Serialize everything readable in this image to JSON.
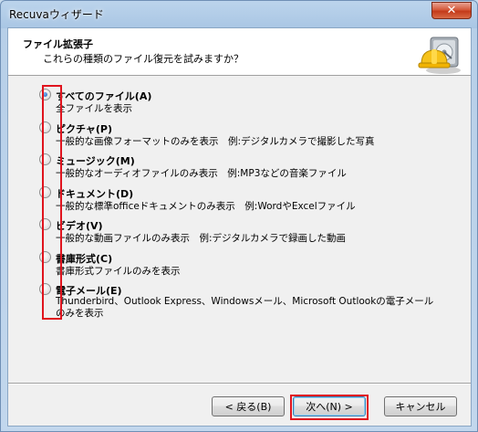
{
  "window": {
    "title": "Recuvaウィザード",
    "close_glyph": "✕"
  },
  "header": {
    "title": "ファイル拡張子",
    "subtitle": "これらの種類のファイル復元を試みますか？",
    "logo_icon": "recuva-hardhat-drive-icon"
  },
  "options": [
    {
      "label": "すべてのファイル(A)",
      "desc": "全ファイルを表示",
      "checked": true
    },
    {
      "label": "ピクチャ(P)",
      "desc": "一般的な画像フォーマットのみを表示　例:デジタルカメラで撮影した写真",
      "checked": false
    },
    {
      "label": "ミュージック(M)",
      "desc": "一般的なオーディオファイルのみ表示　例:MP3などの音楽ファイル",
      "checked": false
    },
    {
      "label": "ドキュメント(D)",
      "desc": "一般的な標準officeドキュメントのみ表示　例:WordやExcelファイル",
      "checked": false
    },
    {
      "label": "ビデオ(V)",
      "desc": "一般的な動画ファイルのみ表示　例:デジタルカメラで録画した動画",
      "checked": false
    },
    {
      "label": "書庫形式(C)",
      "desc": "書庫形式ファイルのみを表示",
      "checked": false
    },
    {
      "label": "電子メール(E)",
      "desc": "Thunderbird、Outlook Express、Windowsメール、Microsoft Outlookの電子メールのみを表示",
      "checked": false
    }
  ],
  "buttons": {
    "back": "< 戻る(B)",
    "next": "次へ(N) >",
    "cancel": "キャンセル"
  },
  "colors": {
    "highlight": "#e0141e",
    "radio_dot": "#1f5fb8"
  }
}
